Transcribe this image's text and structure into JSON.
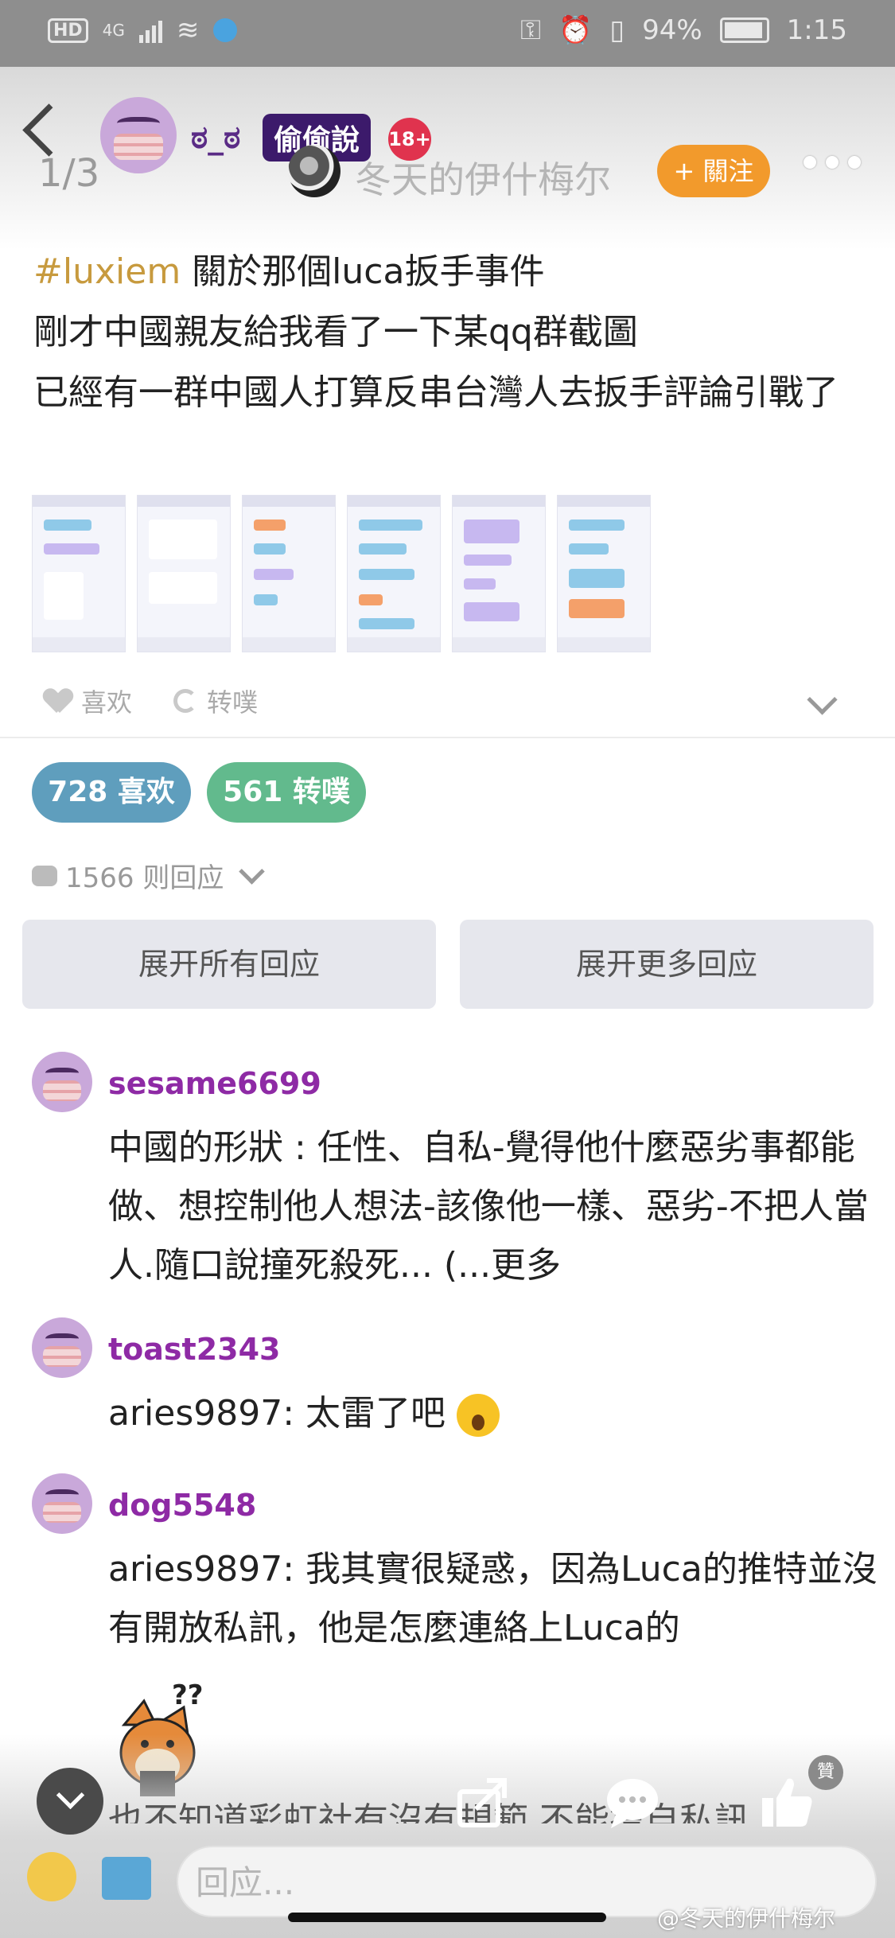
{
  "status_bar": {
    "hd": "HD",
    "net": "4G",
    "battery": "94%",
    "time": "1:15"
  },
  "header": {
    "mood": "ಠ_ಠ",
    "tag": "偷偷說",
    "age_badge": "18+",
    "pager": "1/3",
    "author": "冬天的伊什梅尔",
    "follow_label": "+ 關注"
  },
  "post": {
    "hashtag": "#luxiem",
    "title_rest": " 關於那個luca扳手事件",
    "line2": "剛才中國親友給我看了一下某qq群截圖",
    "line3": "已經有一群中國人打算反串台灣人去扳手評論引戰了"
  },
  "actions": {
    "like_label": "喜欢",
    "repost_label": "转噗"
  },
  "stats": {
    "likes": "728 喜欢",
    "reposts": "561 转噗",
    "reply_count": "1566 则回应"
  },
  "buttons": {
    "expand_all": "展开所有回应",
    "expand_more": "展开更多回应"
  },
  "comments": [
    {
      "user": "sesame6699",
      "text": "中國的形狀 : 任性、自私-覺得他什麼惡劣事都能做、想控制他人想法-該像他一樣、惡劣-不把人當人.隨口說撞死殺死... (...更多"
    },
    {
      "user": "toast2343",
      "text": "aries9897: 太雷了吧"
    },
    {
      "user": "dog5548",
      "text": "aries9897: 我其實很疑惑，因為Luca的推特並沒有開放私訊，他是怎麼連絡上Luca的"
    }
  ],
  "partial_comment": "也不知道彩虹社有沒有規範,不能擅自私訊",
  "bottom": {
    "like_badge": "贊",
    "reply_placeholder": "回应...",
    "watermark": "@冬天的伊什梅尔"
  },
  "colors": {
    "follow": "#f29a2c",
    "like_pill": "#5f9ebd",
    "repost_pill": "#62ba8d",
    "username": "#8e2aa5",
    "hashtag": "#c79a3e"
  },
  "icons": [
    "back-icon",
    "heart-icon",
    "repost-icon",
    "chevron-down-icon",
    "comment-bubble-icon",
    "share-icon",
    "thumbs-up-icon",
    "smile-icon",
    "image-icon",
    "more-icon"
  ]
}
